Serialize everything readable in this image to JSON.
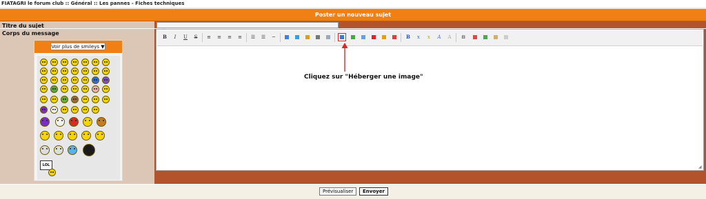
{
  "breadcrumb": "FIATAGRI le forum club :: Général :: Les pannes - Fiches techniques",
  "form": {
    "title": "Poster un nouveau sujet",
    "subject_label": "Titre du sujet",
    "subject_value": "",
    "body_label": "Corps du message"
  },
  "smileys": {
    "more_label": "Voir plus de smileys ▼",
    "lol_label": "LOL"
  },
  "toolbar": {
    "bold": "B",
    "italic": "I",
    "underline": "U",
    "strike": "S",
    "highlighted_tool": "Héberger une image"
  },
  "annotation": {
    "text": "Cliquez sur \"Héberger une image\"",
    "color": "#e0242b"
  },
  "actions": {
    "preview": "Prévisualiser",
    "submit": "Envoyer"
  },
  "colors": {
    "header": "#f07f14",
    "label_column": "#dcc6b6",
    "content_column": "#b3532b"
  }
}
